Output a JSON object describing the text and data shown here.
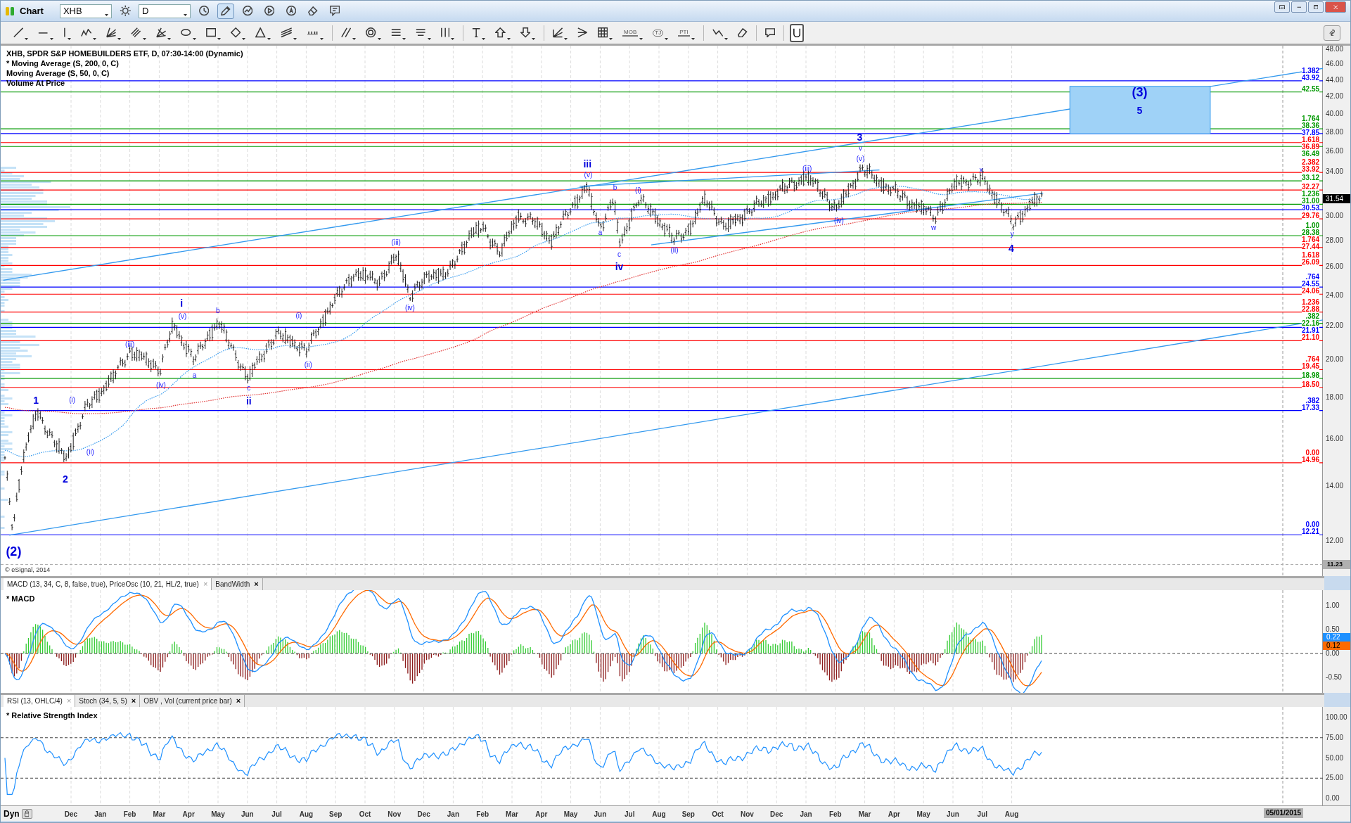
{
  "window": {
    "title": "Chart",
    "symbol": "XHB",
    "interval": "D"
  },
  "title_tools": [
    {
      "kind": "gear",
      "on": false
    },
    {
      "kind": "clock",
      "on": false
    },
    {
      "kind": "pencil",
      "on": true
    },
    {
      "kind": "chart",
      "on": false
    },
    {
      "kind": "play",
      "on": false
    },
    {
      "kind": "circle",
      "on": false
    },
    {
      "kind": "eraser",
      "on": false
    },
    {
      "kind": "note",
      "on": false
    }
  ],
  "toolbar": [
    {
      "kind": "line",
      "dropdown": true,
      "on": false
    },
    {
      "kind": "hline",
      "dropdown": true,
      "on": false
    },
    {
      "kind": "vline",
      "dropdown": true,
      "on": false
    },
    {
      "kind": "polyline",
      "dropdown": true,
      "on": false
    },
    {
      "kind": "fan",
      "dropdown": true,
      "on": false
    },
    {
      "kind": "parallel",
      "dropdown": true,
      "on": false
    },
    {
      "kind": "gann",
      "dropdown": true,
      "on": false
    },
    {
      "kind": "ellipse",
      "dropdown": true,
      "on": false
    },
    {
      "kind": "rect",
      "dropdown": true,
      "on": false
    },
    {
      "kind": "diamond",
      "dropdown": true,
      "on": false
    },
    {
      "kind": "triangle",
      "dropdown": true,
      "on": false
    },
    {
      "kind": "channel",
      "dropdown": true,
      "on": false
    },
    {
      "kind": "comb",
      "dropdown": true,
      "on": false
    },
    {
      "kind": "dslash",
      "dropdown": true,
      "on": false
    },
    {
      "kind": "concentric",
      "dropdown": true,
      "on": false
    },
    {
      "kind": "hlines",
      "dropdown": true,
      "on": false
    },
    {
      "kind": "hlines2",
      "dropdown": true,
      "on": false
    },
    {
      "kind": "vlines",
      "dropdown": true,
      "on": false
    },
    {
      "kind": "text",
      "dropdown": true,
      "on": false
    },
    {
      "kind": "arrowup",
      "dropdown": true,
      "on": false
    },
    {
      "kind": "arrowdown",
      "dropdown": true,
      "on": false
    },
    {
      "kind": "angle",
      "dropdown": true,
      "on": false
    },
    {
      "kind": "fanleft",
      "dropdown": false,
      "on": false
    },
    {
      "kind": "grid",
      "dropdown": true,
      "on": false
    },
    {
      "kind": "badge",
      "label": "MOB",
      "dropdown": true,
      "on": false
    },
    {
      "kind": "oval",
      "label": "TJ",
      "dropdown": true,
      "on": false
    },
    {
      "kind": "badge",
      "label": "PTI",
      "dropdown": true,
      "on": false
    },
    {
      "kind": "zigzag",
      "dropdown": true,
      "on": false
    },
    {
      "kind": "eraser",
      "dropdown": false,
      "on": false
    },
    {
      "kind": "bubble",
      "dropdown": false,
      "on": false
    },
    {
      "kind": "magnet",
      "dropdown": false,
      "on": true
    }
  ],
  "legend": [
    "XHB, SPDR S&P HOMEBUILDERS ETF, D, 07:30-14:00 (Dynamic)",
    "* Moving Average (S, 200, 0, C)",
    "Moving Average (S, 50, 0, C)",
    "Volume At Price"
  ],
  "copyright": "© eSignal, 2014",
  "wave_labels": [
    {
      "text": "(2)",
      "kind": "primary"
    },
    {
      "text": "1",
      "kind": "major"
    },
    {
      "text": "2",
      "kind": "major"
    },
    {
      "text": "(i)",
      "kind": "minor"
    },
    {
      "text": "(ii)",
      "kind": "minor"
    },
    {
      "text": "(iii)",
      "kind": "minor"
    },
    {
      "text": "(iv)",
      "kind": "minor"
    },
    {
      "text": "(v)",
      "kind": "minor"
    },
    {
      "text": "i",
      "kind": "major"
    },
    {
      "text": "a",
      "kind": "minor"
    },
    {
      "text": "b",
      "kind": "minor"
    },
    {
      "text": "c",
      "kind": "minor"
    },
    {
      "text": "ii",
      "kind": "major"
    },
    {
      "text": "(i)",
      "kind": "minor"
    },
    {
      "text": "(ii)",
      "kind": "minor"
    },
    {
      "text": "(iii)",
      "kind": "minor"
    },
    {
      "text": "(iv)",
      "kind": "minor"
    },
    {
      "text": "iii",
      "kind": "major"
    },
    {
      "text": "(v)",
      "kind": "minor"
    },
    {
      "text": "b",
      "kind": "minor"
    },
    {
      "text": "a",
      "kind": "minor"
    },
    {
      "text": "(i)",
      "kind": "minor"
    },
    {
      "text": "c",
      "kind": "minor"
    },
    {
      "text": "iv",
      "kind": "major"
    },
    {
      "text": "(ii)",
      "kind": "minor"
    },
    {
      "text": "(iii)",
      "kind": "minor"
    },
    {
      "text": "(iv)",
      "kind": "minor"
    },
    {
      "text": "3",
      "kind": "major"
    },
    {
      "text": "v",
      "kind": "minor"
    },
    {
      "text": "(v)",
      "kind": "minor"
    },
    {
      "text": "w",
      "kind": "minor"
    },
    {
      "text": "x",
      "kind": "minor"
    },
    {
      "text": "y",
      "kind": "minor"
    },
    {
      "text": "4",
      "kind": "major"
    },
    {
      "text": "(3)",
      "kind": "primary"
    },
    {
      "text": "5",
      "kind": "major"
    }
  ],
  "levels": [
    {
      "ratio": "1.382",
      "price": "43.92",
      "color": "#0000ff"
    },
    {
      "price": "42.55",
      "color": "#009900"
    },
    {
      "ratio": "1.764",
      "price": "38.36",
      "color": "#009900"
    },
    {
      "price": "37.85",
      "color": "#0000ff"
    },
    {
      "ratio": "1.618",
      "price": "36.89",
      "color": "#ff0000"
    },
    {
      "price": "36.49",
      "color": "#009900"
    },
    {
      "ratio": "2.382",
      "price": "33.92",
      "color": "#ff0000"
    },
    {
      "price": "33.12",
      "color": "#009900"
    },
    {
      "price": "32.27",
      "color": "#ff0000"
    },
    {
      "ratio": "1.236",
      "price": "31.00",
      "color": "#009900"
    },
    {
      "price": "30.53",
      "color": "#0000ff"
    },
    {
      "price": "29.76",
      "color": "#ff0000"
    },
    {
      "ratio": "1.00",
      "price": "28.38",
      "color": "#009900"
    },
    {
      "ratio": "1.764",
      "price": "27.44",
      "color": "#ff0000"
    },
    {
      "ratio": "1.618",
      "price": "26.09",
      "color": "#ff0000"
    },
    {
      "ratio": ".764",
      "price": "24.55",
      "color": "#0000ff"
    },
    {
      "price": "24.06",
      "color": "#ff0000"
    },
    {
      "ratio": "1.236",
      "price": "22.88",
      "color": "#ff0000"
    },
    {
      "ratio": ".382",
      "price": "22.16",
      "color": "#009900"
    },
    {
      "price": "21.91",
      "color": "#0000ff"
    },
    {
      "price": "21.10",
      "color": "#ff0000"
    },
    {
      "ratio": ".764",
      "price": "19.45",
      "color": "#ff0000"
    },
    {
      "price": "18.98",
      "color": "#009900"
    },
    {
      "price": "18.50",
      "color": "#ff0000"
    },
    {
      "ratio": ".382",
      "price": "17.33",
      "color": "#0000ff"
    },
    {
      "ratio": "0.00",
      "price": "14.96",
      "color": "#ff0000"
    },
    {
      "ratio": "0.00",
      "price": "12.21",
      "color": "#0000ff"
    }
  ],
  "price_axis": {
    "ticks": [
      "48.00",
      "46.00",
      "44.00",
      "42.00",
      "40.00",
      "38.00",
      "36.00",
      "34.00",
      "30.00",
      "28.00",
      "26.00",
      "24.00",
      "22.00",
      "20.00",
      "18.00",
      "16.00",
      "14.00",
      "12.00"
    ],
    "last_price": "31.54",
    "low_marker": "11.23"
  },
  "macd_panel": {
    "tabs": [
      {
        "label": "MACD (13, 34, C, 8, false, true), PriceOsc (10, 21, HL/2, true)",
        "selected": true,
        "close": "×"
      },
      {
        "label": "BandWidth",
        "selected": false,
        "close": "×"
      }
    ],
    "title": "* MACD",
    "ticks": [
      "1.00",
      "0.50",
      "0.00",
      "-0.50"
    ],
    "macd_value": "0.22",
    "signal_value": "0.12"
  },
  "rsi_panel": {
    "tabs": [
      {
        "label": "RSI (13, OHLC/4)",
        "selected": true,
        "close": "×"
      },
      {
        "label": "Stoch (34, 5, 5)",
        "selected": false,
        "close": "×"
      },
      {
        "label": "OBV , Vol (current price bar)",
        "selected": false,
        "close": "×"
      }
    ],
    "title": "* Relative Strength Index",
    "ticks": [
      "100.00",
      "75.00",
      "50.00",
      "25.00",
      "0.00"
    ]
  },
  "time_axis": {
    "mode": "Dyn",
    "months": [
      "Dec",
      "Jan",
      "Feb",
      "Mar",
      "Apr",
      "May",
      "Jun",
      "Jul",
      "Aug",
      "Sep",
      "Oct",
      "Nov",
      "Dec",
      "Jan",
      "Feb",
      "Mar",
      "Apr",
      "May",
      "Jun",
      "Jul",
      "Aug",
      "Sep",
      "Oct",
      "Nov",
      "Dec",
      "Jan",
      "Feb",
      "Mar",
      "Apr",
      "May",
      "Jun",
      "Jul",
      "Aug"
    ],
    "marker": "05/01/2015"
  }
}
